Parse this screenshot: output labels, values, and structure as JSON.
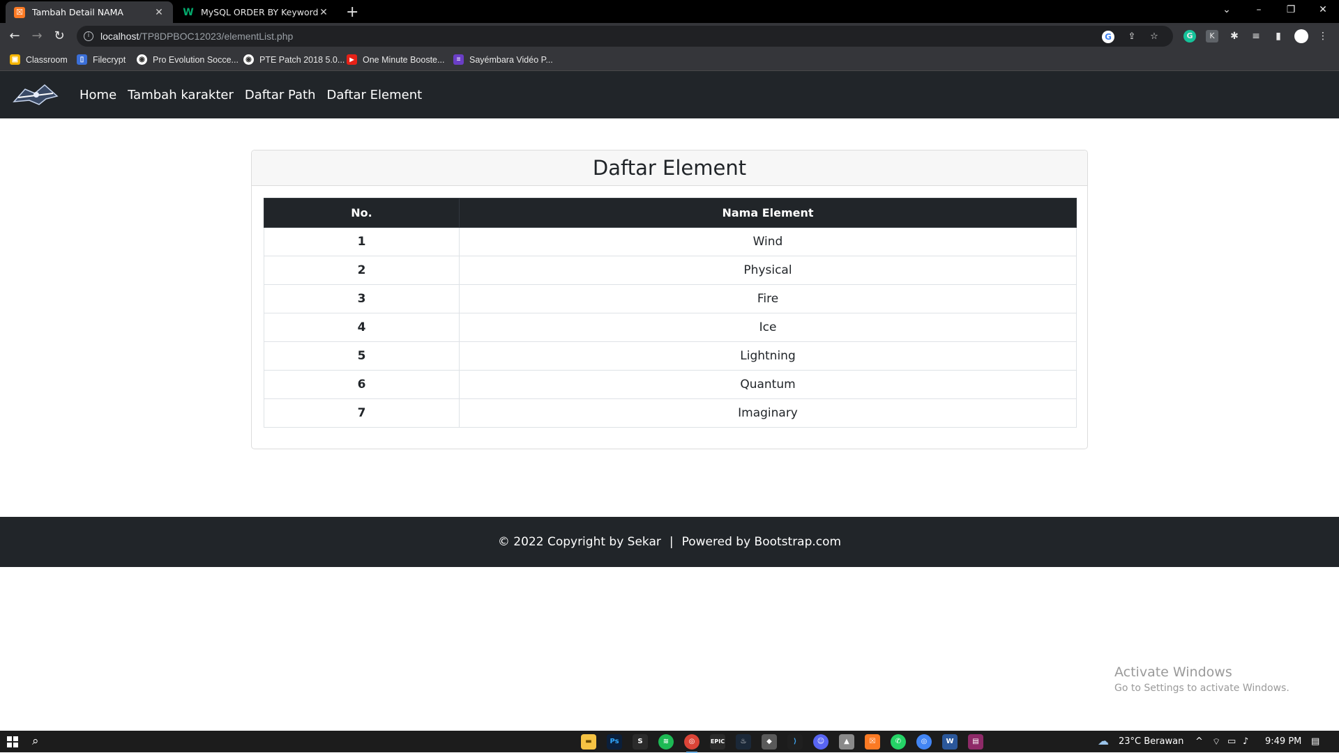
{
  "browser": {
    "tabs": [
      {
        "title": "Tambah Detail NAMA",
        "active": true
      },
      {
        "title": "MySQL ORDER BY Keyword",
        "active": false
      }
    ],
    "url_host": "localhost",
    "url_path": "/TP8DPBOC12023/elementList.php",
    "bookmarks": [
      {
        "label": "Classroom",
        "color": "#f4b400"
      },
      {
        "label": "Filecrypt",
        "color": "#3b6fd8"
      },
      {
        "label": "Pro Evolution Socce...",
        "color": "#555555"
      },
      {
        "label": "PTE Patch 2018 5.0...",
        "color": "#555555"
      },
      {
        "label": "One Minute Booste...",
        "color": "#e62117"
      },
      {
        "label": "Sayémbara Vidéo P...",
        "color": "#6a3ec6"
      }
    ]
  },
  "navbar": {
    "brand_icon": "game-logo-icon",
    "links": [
      "Home",
      "Tambah karakter",
      "Daftar Path",
      "Daftar Element"
    ]
  },
  "card": {
    "title": "Daftar Element",
    "columns": [
      "No.",
      "Nama Element"
    ],
    "rows": [
      {
        "no": "1",
        "name": "Wind"
      },
      {
        "no": "2",
        "name": "Physical"
      },
      {
        "no": "3",
        "name": "Fire"
      },
      {
        "no": "4",
        "name": "Ice"
      },
      {
        "no": "5",
        "name": "Lightning"
      },
      {
        "no": "6",
        "name": "Quantum"
      },
      {
        "no": "7",
        "name": "Imaginary"
      }
    ]
  },
  "footer": {
    "copyright": "© 2022 Copyright by Sekar",
    "separator": "|",
    "powered": "Powered by Bootstrap.com"
  },
  "watermark": {
    "line1": "Activate Windows",
    "line2": "Go to Settings to activate Windows."
  },
  "taskbar": {
    "weather": "23°C  Berawan",
    "time": "9:49 PM"
  },
  "colors": {
    "navbar_bg": "#212529",
    "table_head_bg": "#212529",
    "card_header_bg": "#f7f7f7",
    "page_bg": "#ffffff"
  }
}
